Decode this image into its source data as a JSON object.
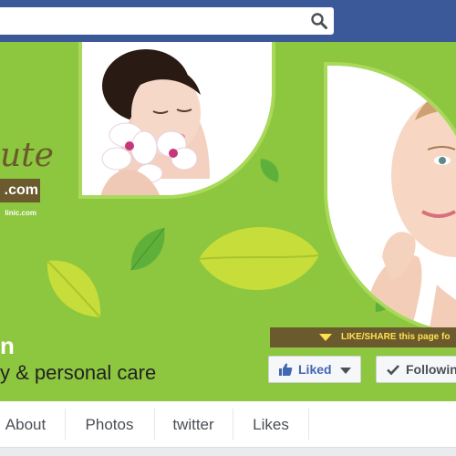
{
  "search": {
    "placeholder": "",
    "value": ""
  },
  "cover": {
    "brand_script": "ute",
    "brand_domain": ".com",
    "brand_url": "linic.com"
  },
  "page": {
    "name": "n",
    "category": "y & personal care"
  },
  "actions": {
    "share_banner": "LIKE/SHARE this page fo",
    "liked_label": "Liked",
    "following_label": "Followin"
  },
  "tabs": [
    {
      "label": "About"
    },
    {
      "label": "Photos"
    },
    {
      "label": "twitter"
    },
    {
      "label": "Likes"
    }
  ],
  "colors": {
    "header_blue": "#3b5998",
    "cover_green": "#8dc63f",
    "brand_brown": "#6b5a2e",
    "banner_yellow": "#ffe14d"
  }
}
